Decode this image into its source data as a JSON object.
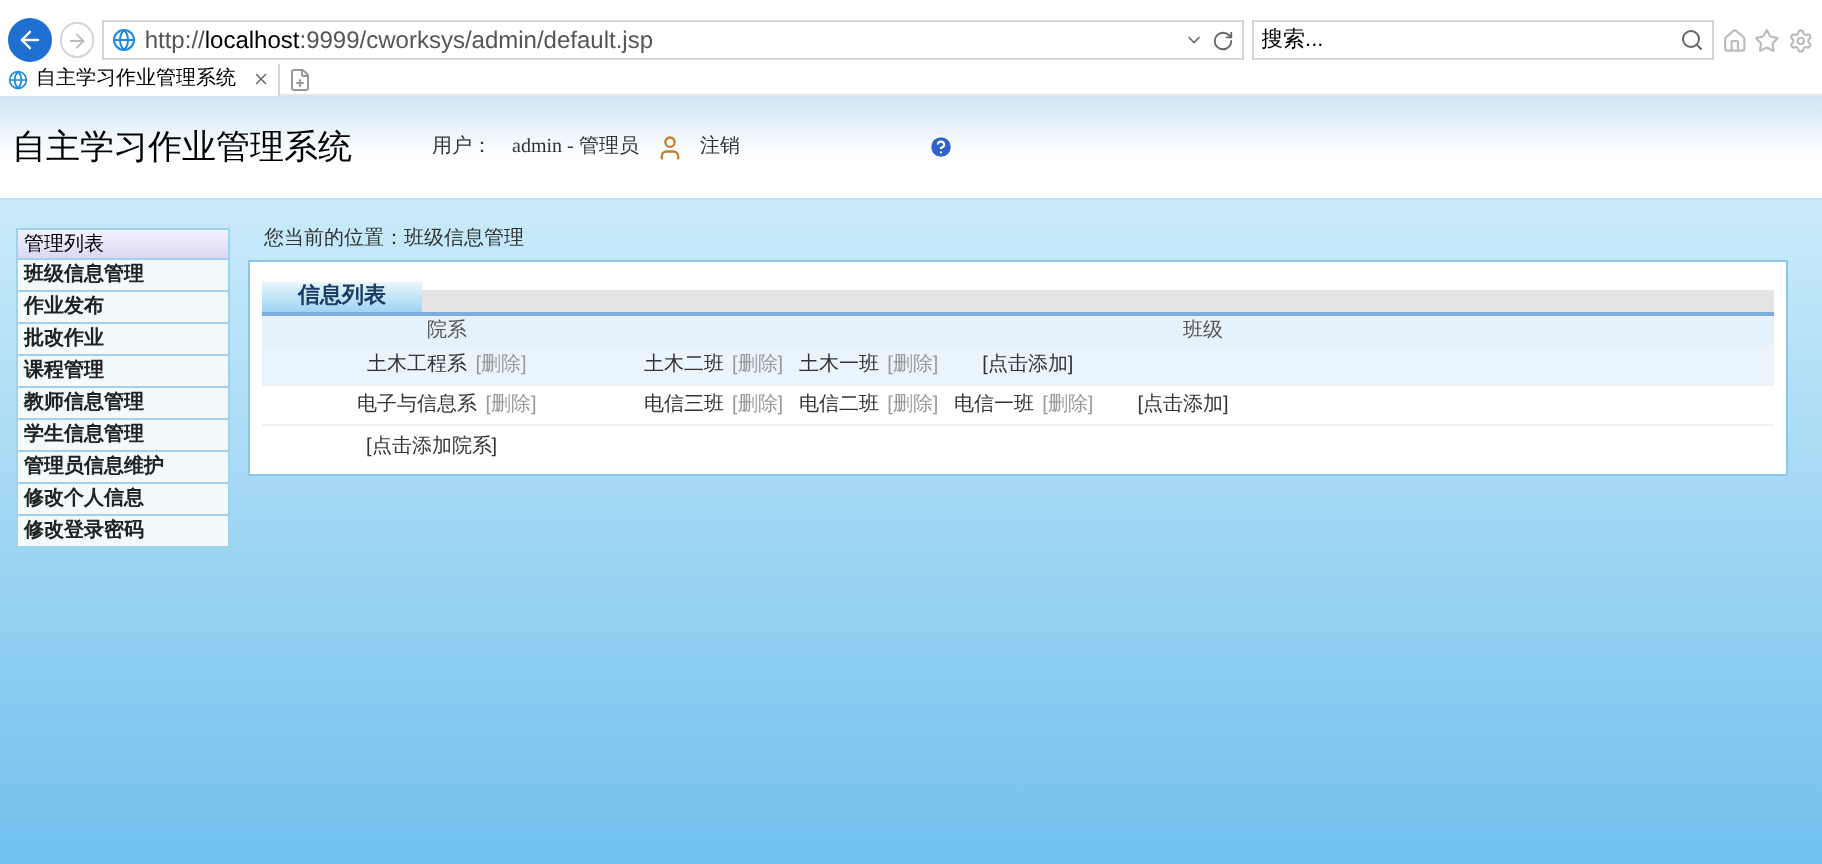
{
  "browser": {
    "url_parts": [
      "http://",
      "localhost",
      ":9999/cworksys/admin/default.jsp"
    ],
    "search_placeholder": "搜索...",
    "tab_title": "自主学习作业管理系统"
  },
  "header": {
    "title": "自主学习作业管理系统",
    "user_label": "用户：",
    "user_value": "admin - 管理员",
    "logout": "注销"
  },
  "sidebar": {
    "title": "管理列表",
    "items": [
      "班级信息管理",
      "作业发布",
      "批改作业",
      "课程管理",
      "教师信息管理",
      "学生信息管理",
      "管理员信息维护",
      "修改个人信息",
      "修改登录密码"
    ]
  },
  "breadcrumb": "您当前的位置：班级信息管理",
  "panel": {
    "tab": "信息列表",
    "columns": [
      "院系",
      "班级"
    ],
    "rows": [
      {
        "department": "土木工程系",
        "delete": "[删除]",
        "highlighted": true,
        "classes": [
          {
            "name": "土木二班",
            "delete": "[删除]"
          },
          {
            "name": "土木一班",
            "delete": "[删除]"
          }
        ],
        "add": "[点击添加]"
      },
      {
        "department": "电子与信息系",
        "delete": "[删除]",
        "highlighted": false,
        "classes": [
          {
            "name": "电信三班",
            "delete": "[删除]"
          },
          {
            "name": "电信二班",
            "delete": "[删除]"
          },
          {
            "name": "电信一班",
            "delete": "[删除]"
          }
        ],
        "add": "[点击添加]"
      }
    ],
    "add_department": "[点击添加院系]"
  }
}
